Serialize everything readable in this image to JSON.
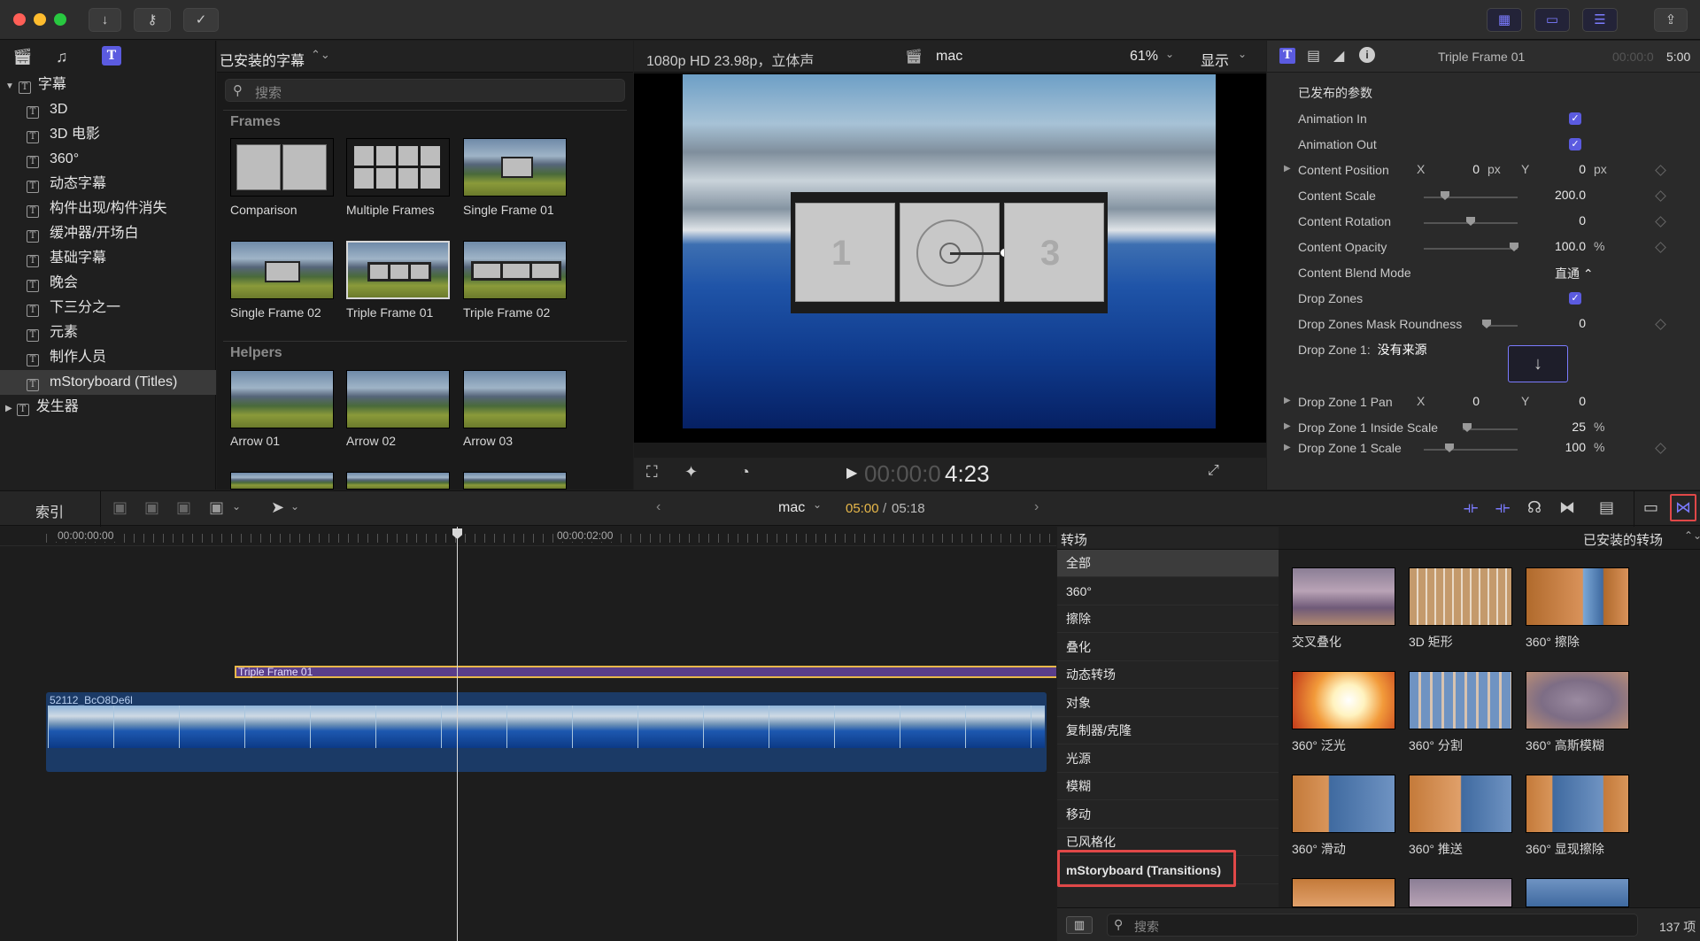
{
  "library": {
    "items": [
      {
        "label": "字幕",
        "level": 0,
        "expanded": true
      },
      {
        "label": "3D",
        "level": 1
      },
      {
        "label": "3D 电影",
        "level": 1
      },
      {
        "label": "360°",
        "level": 1
      },
      {
        "label": "动态字幕",
        "level": 1
      },
      {
        "label": "构件出现/构件消失",
        "level": 1
      },
      {
        "label": "缓冲器/开场白",
        "level": 1
      },
      {
        "label": "基础字幕",
        "level": 1
      },
      {
        "label": "晚会",
        "level": 1
      },
      {
        "label": "下三分之一",
        "level": 1
      },
      {
        "label": "元素",
        "level": 1
      },
      {
        "label": "制作人员",
        "level": 1
      },
      {
        "label": "mStoryboard (Titles)",
        "level": 1,
        "selected": true
      },
      {
        "label": "发生器",
        "level": 0,
        "expanded": false
      }
    ]
  },
  "browser": {
    "header": "已安装的字幕",
    "search_placeholder": "搜索",
    "frames_heading": "Frames",
    "helpers_heading": "Helpers",
    "frames": [
      "Comparison",
      "Multiple Frames",
      "Single Frame 01",
      "Single Frame 02",
      "Triple Frame 01",
      "Triple Frame 02"
    ],
    "helpers": [
      "Arrow 01",
      "Arrow 02",
      "Arrow 03"
    ]
  },
  "viewer": {
    "format": "1080p HD 23.98p，立体声",
    "project": "mac",
    "zoom": "61%",
    "display": "显示",
    "timecode_dim": "00:00:0",
    "timecode_bright": "4:23"
  },
  "inspector": {
    "title": "Triple Frame 01",
    "time_dim": "00:00:0",
    "time_bright": "5:00",
    "section": "已发布的参数",
    "rows": {
      "anim_in": "Animation In",
      "anim_out": "Animation Out",
      "content_position": "Content Position",
      "pos_x_label": "X",
      "pos_x_value": "0",
      "pos_x_unit": "px",
      "pos_y_label": "Y",
      "pos_y_value": "0",
      "pos_y_unit": "px",
      "content_scale": "Content Scale",
      "content_scale_value": "200.0",
      "content_rotation": "Content Rotation",
      "content_rotation_value": "0",
      "content_opacity": "Content Opacity",
      "content_opacity_value": "100.0",
      "content_opacity_unit": "%",
      "blend_mode": "Content Blend Mode",
      "blend_mode_value": "直通 ⌃",
      "drop_zones": "Drop Zones",
      "mask_roundness": "Drop Zones Mask Roundness",
      "mask_roundness_value": "0",
      "drop_zone1": "Drop Zone 1:",
      "drop_zone1_source": "没有来源",
      "dz1_pan": "Drop Zone 1 Pan",
      "dz1_pan_x_label": "X",
      "dz1_pan_x": "0",
      "dz1_pan_y_label": "Y",
      "dz1_pan_y": "0",
      "dz1_inside_scale": "Drop Zone 1 Inside Scale",
      "dz1_inside_scale_value": "25",
      "dz1_inside_scale_unit": "%",
      "dz1_scale": "Drop Zone 1 Scale",
      "dz1_scale_value": "100",
      "dz1_scale_unit": "%"
    }
  },
  "timeline_bar": {
    "index": "索引",
    "project": "mac",
    "time_current": "05:00",
    "time_sep": " / ",
    "time_total": "05:18"
  },
  "timeline": {
    "ruler_start": "00:00:00:00",
    "ruler_mid": "00:00:02:00",
    "title_clip": "Triple Frame 01",
    "video_clip": "52112_BcO8De6l"
  },
  "transitions": {
    "header": "转场",
    "installed": "已安装的转场",
    "categories": [
      "全部",
      "360°",
      "擦除",
      "叠化",
      "动态转场",
      "对象",
      "复制器/克隆",
      "光源",
      "模糊",
      "移动",
      "已风格化",
      "mStoryboard (Transitions)"
    ],
    "items": [
      "交叉叠化",
      "3D 矩形",
      "360° 擦除",
      "360° 泛光",
      "360° 分割",
      "360° 高斯模糊",
      "360° 滑动",
      "360° 推送",
      "360° 显现擦除"
    ],
    "search_placeholder": "搜索",
    "count": "137 项"
  },
  "colors": {
    "accent": "#5b5be0",
    "highlight": "#e04848",
    "timecode": "#e8b84a",
    "title_clip": "#5a3e8a"
  }
}
